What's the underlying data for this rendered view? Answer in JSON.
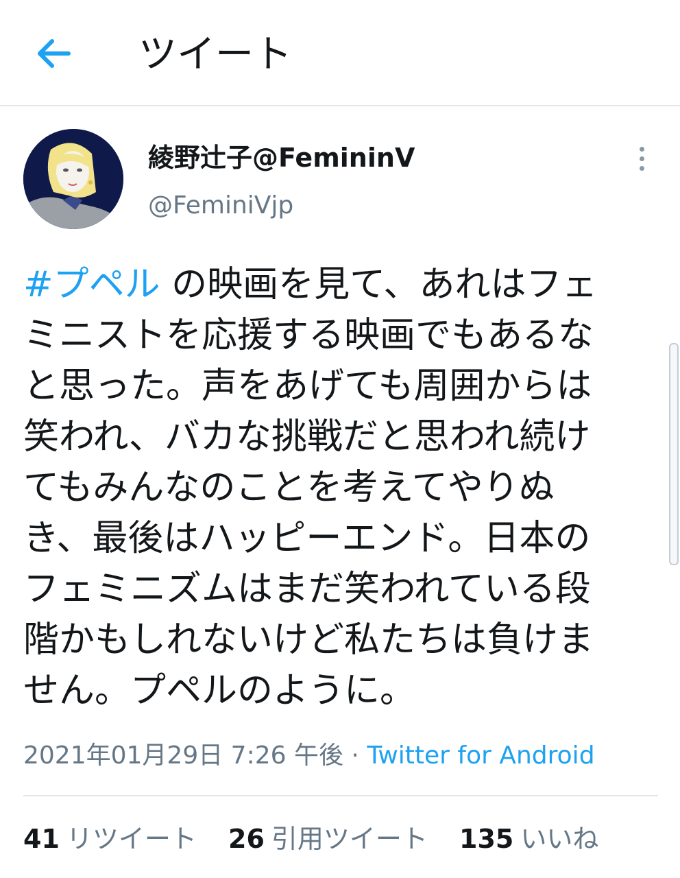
{
  "header": {
    "title": "ツイート",
    "back_icon": "arrow-left-icon"
  },
  "author": {
    "display_name": "綾野辻子@FemininV",
    "handle": "@FeminiVjp"
  },
  "tweet": {
    "hashtag": "#プペル",
    "text": " の映画を見て、あれはフェ\nミニストを応援する映画でもあるな\nと思った。声をあげても周囲からは\n笑われ、バカな挑戦だと思われ続け\nてもみんなのことを考えてやりぬ\nき、最後はハッピーエンド。日本の\nフェミニズムはまだ笑われている段\n階かもしれないけど私たちは負けま\nせん。プペルのように。",
    "timestamp": "2021年01月29日 7:26 午後",
    "separator": " · ",
    "source": "Twitter for Android"
  },
  "stats": {
    "retweets_count": "41",
    "retweets_label": "リツイート",
    "quotes_count": "26",
    "quotes_label": "引用ツイート",
    "likes_count": "135",
    "likes_label": "いいね"
  },
  "colors": {
    "accent": "#1da1f2",
    "secondary_text": "#657786",
    "primary_text": "#14171a",
    "divider": "#e1e6ea"
  }
}
